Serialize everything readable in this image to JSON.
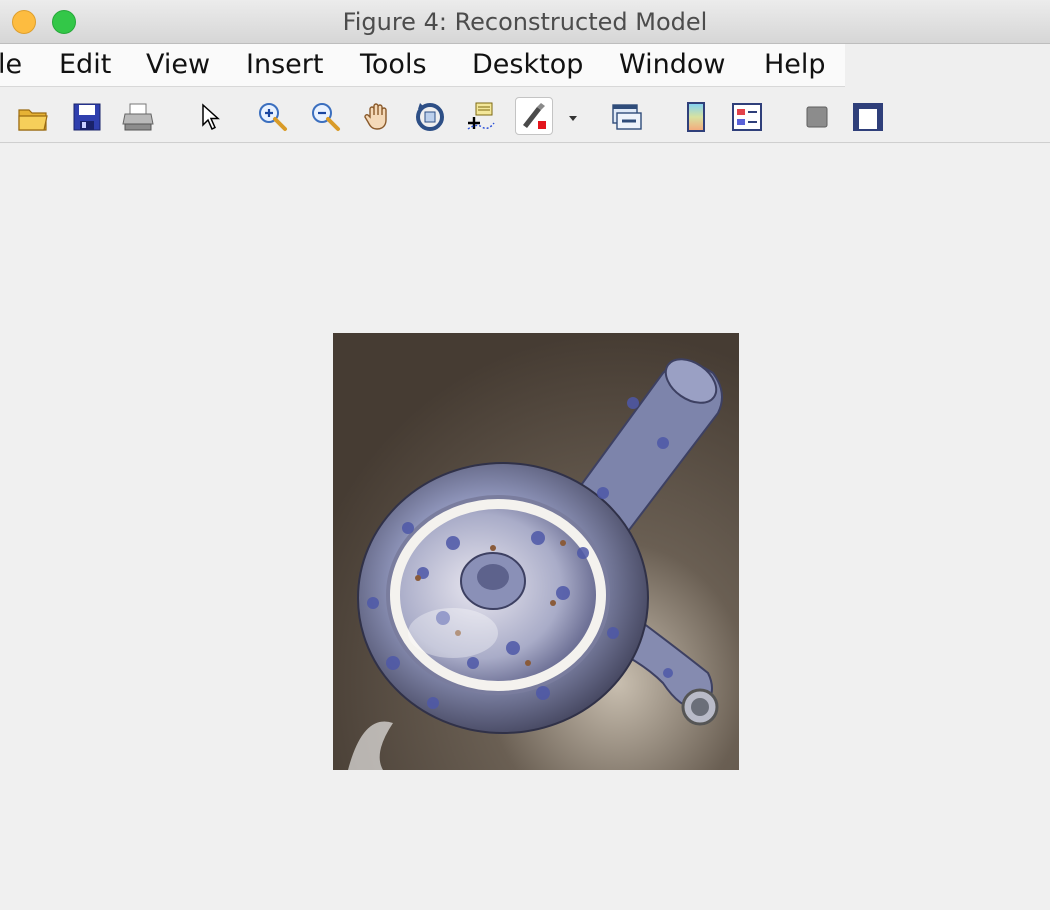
{
  "window": {
    "title": "Figure 4: Reconstructed Model"
  },
  "menu": {
    "items": [
      "le",
      "Edit",
      "View",
      "Insert",
      "Tools",
      "Desktop",
      "Window",
      "Help"
    ]
  },
  "toolbar": {
    "icons": [
      "open-folder-icon",
      "save-icon",
      "print-icon",
      "pointer-icon",
      "zoom-in-icon",
      "zoom-out-icon",
      "pan-icon",
      "rotate-3d-icon",
      "data-cursor-icon",
      "brush-icon",
      "brush-dropdown-icon",
      "link-plot-icon",
      "colorbar-icon",
      "legend-icon",
      "hide-plot-tools-icon",
      "show-plot-tools-icon"
    ]
  },
  "figure": {
    "content": "teapot-render-image"
  },
  "colors": {
    "titlebar": "#e4e4e4",
    "menubar": "#fafafa",
    "background": "#f0f0f0",
    "min_button": "#fdbc40",
    "max_button": "#33c748"
  }
}
